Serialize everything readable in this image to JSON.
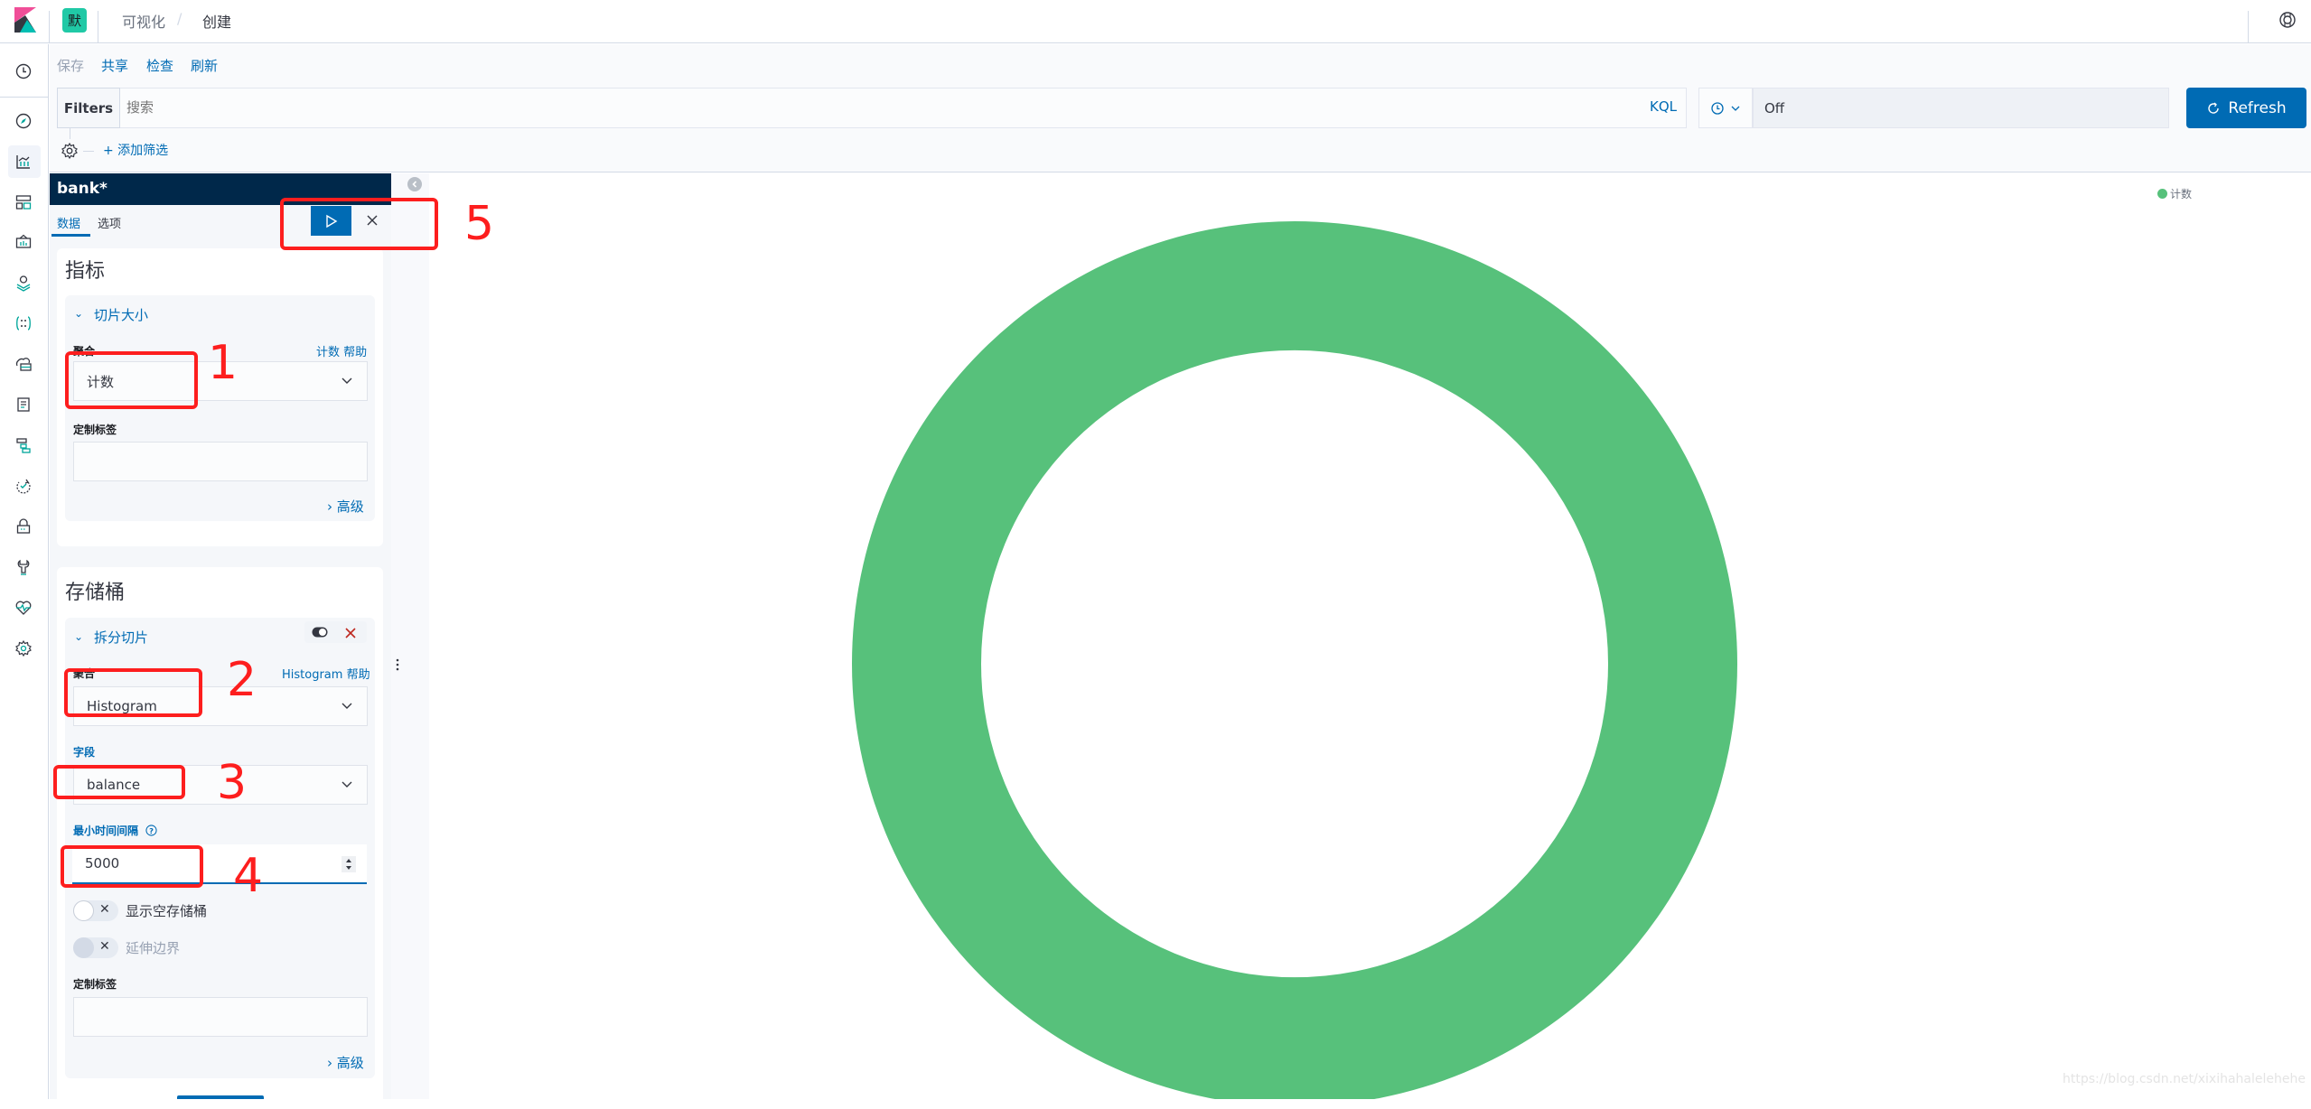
{
  "header": {
    "space_badge": "默",
    "breadcrumbs": [
      "可视化",
      "/",
      "创建"
    ]
  },
  "nav": {
    "items": [
      "recently-viewed",
      "discover",
      "visualize",
      "dashboard",
      "canvas",
      "maps",
      "machine-learning",
      "infrastructure",
      "logs",
      "apm",
      "uptime",
      "siem",
      "dev-tools",
      "monitoring",
      "management"
    ],
    "active": "visualize"
  },
  "toolbar": {
    "save": "保存",
    "share": "共享",
    "inspect": "检查",
    "refresh": "刷新"
  },
  "query": {
    "filters_label": "Filters",
    "search_placeholder": "搜索",
    "language": "KQL",
    "refresh_interval": "Off",
    "refresh_button": "Refresh",
    "add_filter": "+ 添加筛选"
  },
  "editor": {
    "index_pattern": "bank*",
    "tabs": [
      "数据",
      "选项"
    ],
    "active_tab": "数据",
    "metrics": {
      "title": "指标",
      "item_title": "切片大小",
      "aggregation_label": "聚合",
      "aggregation_help": "计数 帮助",
      "aggregation_value": "计数",
      "custom_label": "定制标签",
      "custom_label_value": "",
      "advanced": "高级"
    },
    "buckets": {
      "title": "存储桶",
      "item_title": "拆分切片",
      "aggregation_label": "聚合",
      "aggregation_help": "Histogram 帮助",
      "aggregation_value": "Histogram",
      "field_label": "字段",
      "field_value": "balance",
      "interval_label": "最小时间间隔",
      "interval_value": "5000",
      "show_empty_buckets": "显示空存储桶",
      "show_empty_buckets_on": false,
      "extend_bounds": "延伸边界",
      "extend_bounds_on": false,
      "extend_bounds_disabled": true,
      "custom_label": "定制标签",
      "custom_label_value": "",
      "advanced": "高级"
    }
  },
  "chart_data": {
    "type": "pie",
    "donut": true,
    "title": "",
    "categories": [
      "计数"
    ],
    "values": [
      1
    ],
    "colors": [
      "#57c17b"
    ],
    "legend": [
      "计数"
    ],
    "legend_position": "top-right"
  },
  "annotations": [
    "1",
    "2",
    "3",
    "4",
    "5"
  ],
  "watermark": "https://blog.csdn.net/xixihahalelehehe",
  "colors": {
    "accent": "#006bb4",
    "header_dark": "#00284a",
    "annotation": "#fd1e1e",
    "slice": "#57c17b"
  }
}
